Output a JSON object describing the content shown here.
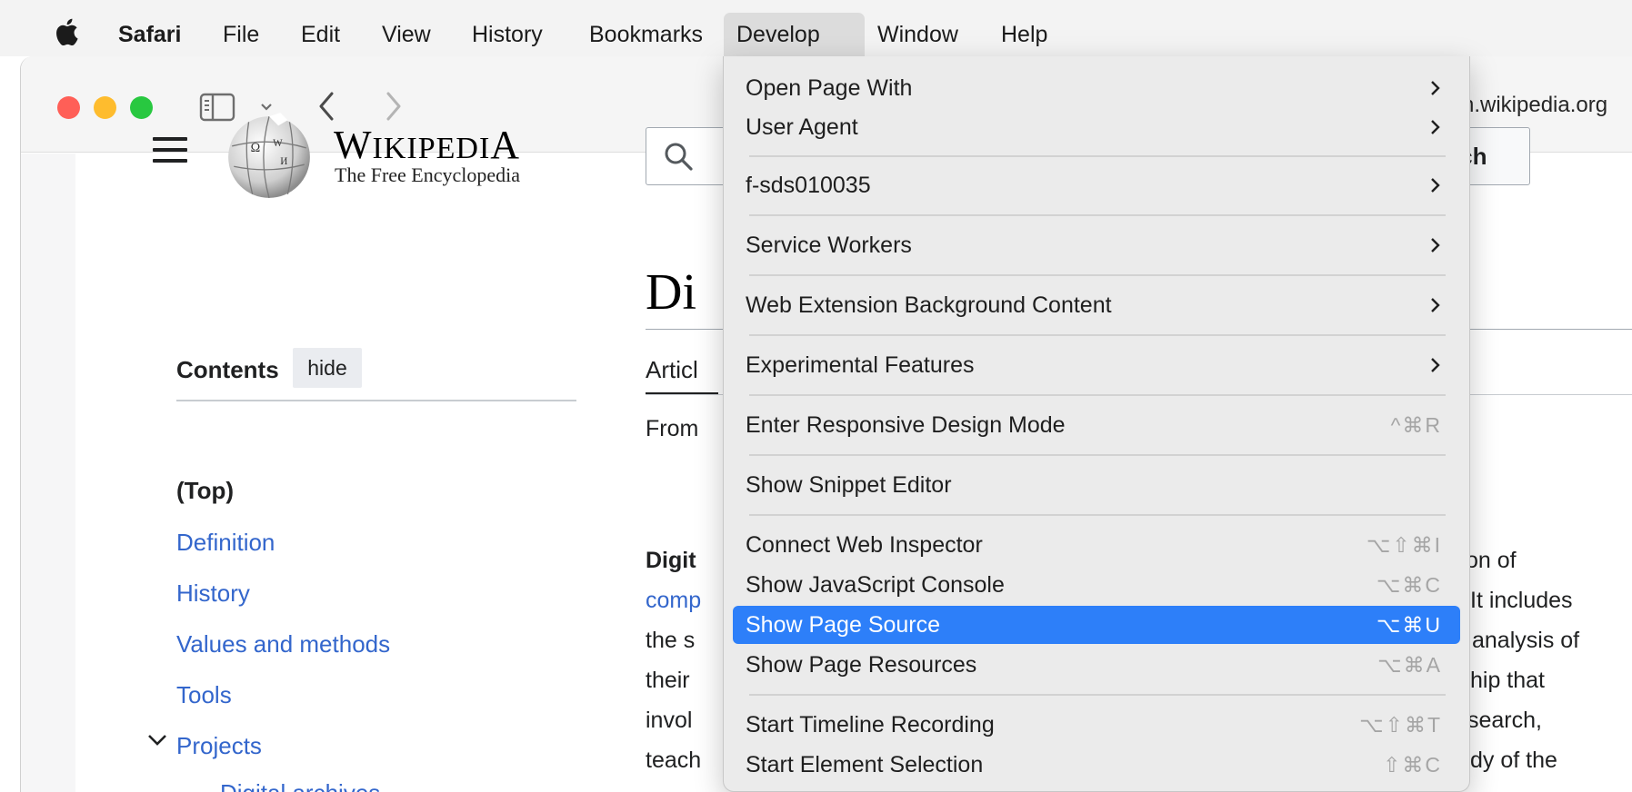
{
  "menubar": {
    "apple_icon": "apple-logo-icon",
    "app_name": "Safari",
    "items": [
      "File",
      "Edit",
      "View",
      "History",
      "Bookmarks",
      "Develop",
      "Window",
      "Help"
    ],
    "active_item": "Develop"
  },
  "toolbar": {
    "sidebar_icon": "sidebar-icon",
    "back_icon": "chevron-left-icon",
    "forward_icon": "chevron-right-icon",
    "url_visible": "n.wikipedia.org"
  },
  "wiki": {
    "wordmark_first": "W",
    "wordmark_rest": "IKIPEDI",
    "wordmark_last": "A",
    "tagline": "The Free Encyclopedia",
    "search_button_visible": "rch",
    "title_visible": "Di",
    "tab_visible": "Articl",
    "from_visible": "From",
    "body_left": [
      "Digit",
      "comp",
      "the s",
      "their",
      "invol",
      "teach"
    ],
    "body_right": [
      "on of",
      "It includes",
      "analysis of",
      "hip that",
      "search,",
      "dy of the"
    ],
    "contents": {
      "title": "Contents",
      "hide_label": "hide",
      "items": [
        "(Top)",
        "Definition",
        "History",
        "Values and methods",
        "Tools",
        "Projects",
        "Digital archives"
      ]
    }
  },
  "develop_menu": {
    "items": [
      {
        "label": "Open Page With",
        "submenu": true,
        "shortcut": ""
      },
      {
        "label": "User Agent",
        "submenu": true,
        "shortcut": ""
      },
      {
        "label": "f-sds010035",
        "submenu": true,
        "shortcut": ""
      },
      {
        "label": "Service Workers",
        "submenu": true,
        "shortcut": ""
      },
      {
        "label": "Web Extension Background Content",
        "submenu": true,
        "shortcut": ""
      },
      {
        "label": "Experimental Features",
        "submenu": true,
        "shortcut": ""
      },
      {
        "label": "Enter Responsive Design Mode",
        "submenu": false,
        "shortcut": "^⌘R"
      },
      {
        "label": "Show Snippet Editor",
        "submenu": false,
        "shortcut": ""
      },
      {
        "label": "Connect Web Inspector",
        "submenu": false,
        "shortcut": "⌥⇧⌘I"
      },
      {
        "label": "Show JavaScript Console",
        "submenu": false,
        "shortcut": "⌥⌘C"
      },
      {
        "label": "Show Page Source",
        "submenu": false,
        "shortcut": "⌥⌘U",
        "highlighted": true
      },
      {
        "label": "Show Page Resources",
        "submenu": false,
        "shortcut": "⌥⌘A"
      },
      {
        "label": "Start Timeline Recording",
        "submenu": false,
        "shortcut": "⌥⇧⌘T"
      },
      {
        "label": "Start Element Selection",
        "submenu": false,
        "shortcut": "⇧⌘C"
      }
    ]
  },
  "colors": {
    "highlight": "#2d7ff9",
    "link": "#3366cc",
    "traffic_red": "#ff5f57",
    "traffic_yellow": "#febc2e",
    "traffic_green": "#28c840"
  }
}
